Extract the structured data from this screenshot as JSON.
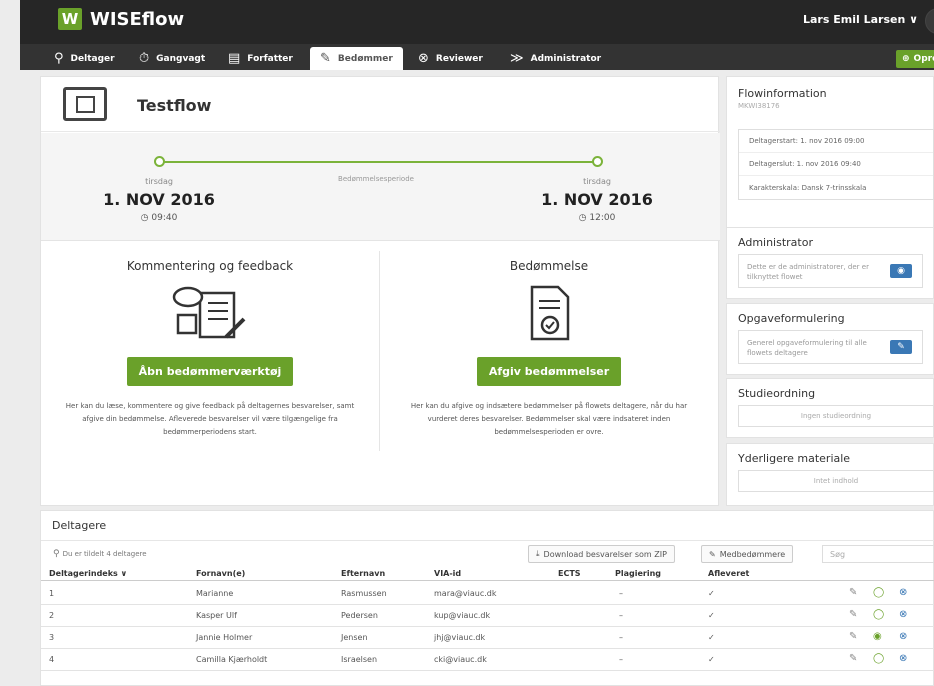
{
  "app": {
    "logo_mark": "W",
    "name": "WISEflow",
    "user": "Lars Emil Larsen ∨"
  },
  "tabs": [
    {
      "label": "Deltager",
      "icon": "participant-icon"
    },
    {
      "label": "Gangvagt",
      "icon": "stopwatch-icon"
    },
    {
      "label": "Forfatter",
      "icon": "author-icon"
    },
    {
      "label": "Bedømmer",
      "icon": "assessor-icon",
      "active": true
    },
    {
      "label": "Reviewer",
      "icon": "reviewer-icon"
    },
    {
      "label": "Administrator",
      "icon": "admin-icon"
    }
  ],
  "create_button": "Opret",
  "flow": {
    "title": "Testflow",
    "timeline": {
      "start_day": "tirsdag",
      "start_date": "1. NOV 2016",
      "start_time": "09:40",
      "period_label": "Bedømmelsesperiode",
      "end_day": "tirsdag",
      "end_date": "1. NOV 2016",
      "end_time": "12:00"
    },
    "feedback": {
      "title": "Kommentering og feedback",
      "button": "Åbn bedømmerværktøj",
      "description": "Her kan du læse, kommentere og give feedback på deltagernes besvarelser, samt afgive din bedømmelse. Afleverede besvarelser vil være tilgængelige fra bedømmerperiodens start."
    },
    "grading": {
      "title": "Bedømmelse",
      "button": "Afgiv bedømmelser",
      "description": "Her kan du afgive og indsætere bedømmelser på flowets deltagere, når du har vurderet deres besvarelser. Bedømmelser skal være indsateret inden bedømmelsesperioden er ovre."
    }
  },
  "sidebar": {
    "flowinfo": {
      "title": "Flowinformation",
      "code": "MKWI38176",
      "lines": [
        "Deltagerstart: 1. nov 2016 09:00",
        "Deltagerslut: 1. nov 2016 09:40",
        "Karakterskala: Dansk 7-trinsskala"
      ]
    },
    "admin": {
      "title": "Administrator",
      "note": "Dette er de administratorer, der er tilknyttet flowet"
    },
    "assignment": {
      "title": "Opgaveformulering",
      "note": "Generel opgaveformulering til alle flowets deltagere"
    },
    "study": {
      "title": "Studieordning",
      "empty": "Ingen studieordning"
    },
    "extra": {
      "title": "Yderligere materiale",
      "empty": "Intet indhold"
    }
  },
  "participants": {
    "title": "Deltagere",
    "count_text": "Du er tildelt 4 deltagere",
    "download_button": "Download besvarelser som ZIP",
    "coassessors_button": "Medbedømmere",
    "search_placeholder": "Søg",
    "columns": [
      "Deltagerindeks ∨",
      "Fornavn(e)",
      "Efternavn",
      "VIA-id",
      "ECTS",
      "Plagiering",
      "Afleveret"
    ],
    "rows": [
      {
        "index": "1",
        "first": "Marianne",
        "last": "Rasmussen",
        "via": "mara@viauc.dk",
        "ects": "",
        "plag": "–",
        "submitted": "✓"
      },
      {
        "index": "2",
        "first": "Kasper Ulf",
        "last": "Pedersen",
        "via": "kup@viauc.dk",
        "ects": "",
        "plag": "–",
        "submitted": "✓"
      },
      {
        "index": "3",
        "first": "Jannie Holmer",
        "last": "Jensen",
        "via": "jhj@viauc.dk",
        "ects": "",
        "plag": "–",
        "submitted": "✓"
      },
      {
        "index": "4",
        "first": "Camilla Kjærholdt",
        "last": "Israelsen",
        "via": "cki@viauc.dk",
        "ects": "",
        "plag": "–",
        "submitted": "✓"
      }
    ]
  },
  "colors": {
    "accent": "#6aa12a",
    "header": "#262626",
    "tabbar": "#333333",
    "blue": "#3a78b5"
  }
}
